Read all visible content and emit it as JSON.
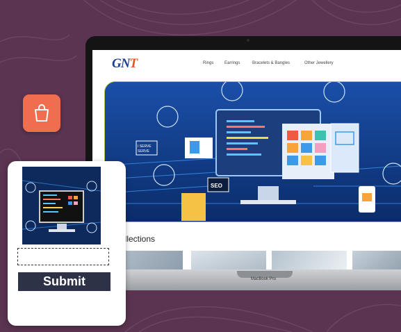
{
  "site": {
    "logo_main": "GN",
    "logo_accent": "T",
    "nav": [
      "Rings",
      "Earrings",
      "Bracelets & Bangles",
      "Other Jewellery"
    ],
    "hero_badge": "SEO",
    "hero_sign": "I SERVE\nSERVE",
    "collections_heading": "v Collections"
  },
  "laptop": {
    "brand": "MacBook Pro"
  },
  "bag_button": {
    "icon": "shopping-bag-icon",
    "color": "#ef6e4f"
  },
  "form": {
    "input_value": "",
    "input_placeholder": "",
    "submit_label": "Submit"
  },
  "colors": {
    "background": "#5a3450",
    "hero_border": "#b4c640",
    "submit_bg": "#2d3246"
  }
}
